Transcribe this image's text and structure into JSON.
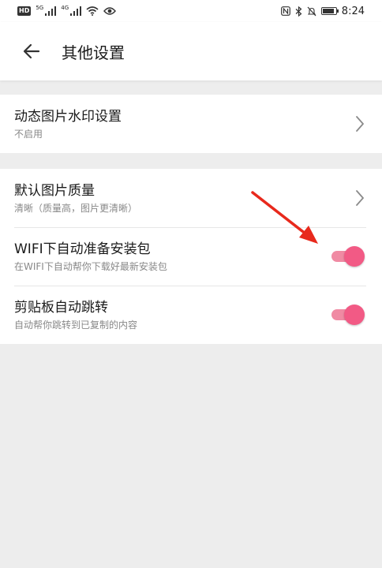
{
  "status_bar": {
    "hd": "HD",
    "net1": "5G",
    "net2": "4G",
    "time": "8:24"
  },
  "header": {
    "title": "其他设置"
  },
  "sections": {
    "watermark": {
      "title": "动态图片水印设置",
      "subtitle": "不启用"
    },
    "quality": {
      "title": "默认图片质量",
      "subtitle": "清晰（质量高，图片更清晰）"
    },
    "wifi_package": {
      "title": "WIFI下自动准备安装包",
      "subtitle": "在WIFI下自动帮你下载好最新安装包",
      "enabled": true
    },
    "clipboard_jump": {
      "title": "剪贴板自动跳转",
      "subtitle": "自动帮你跳转到已复制的内容",
      "enabled": true
    }
  },
  "colors": {
    "toggle_track": "#f08aa3",
    "toggle_thumb": "#f25a85",
    "annotation_arrow": "#e8291c"
  }
}
